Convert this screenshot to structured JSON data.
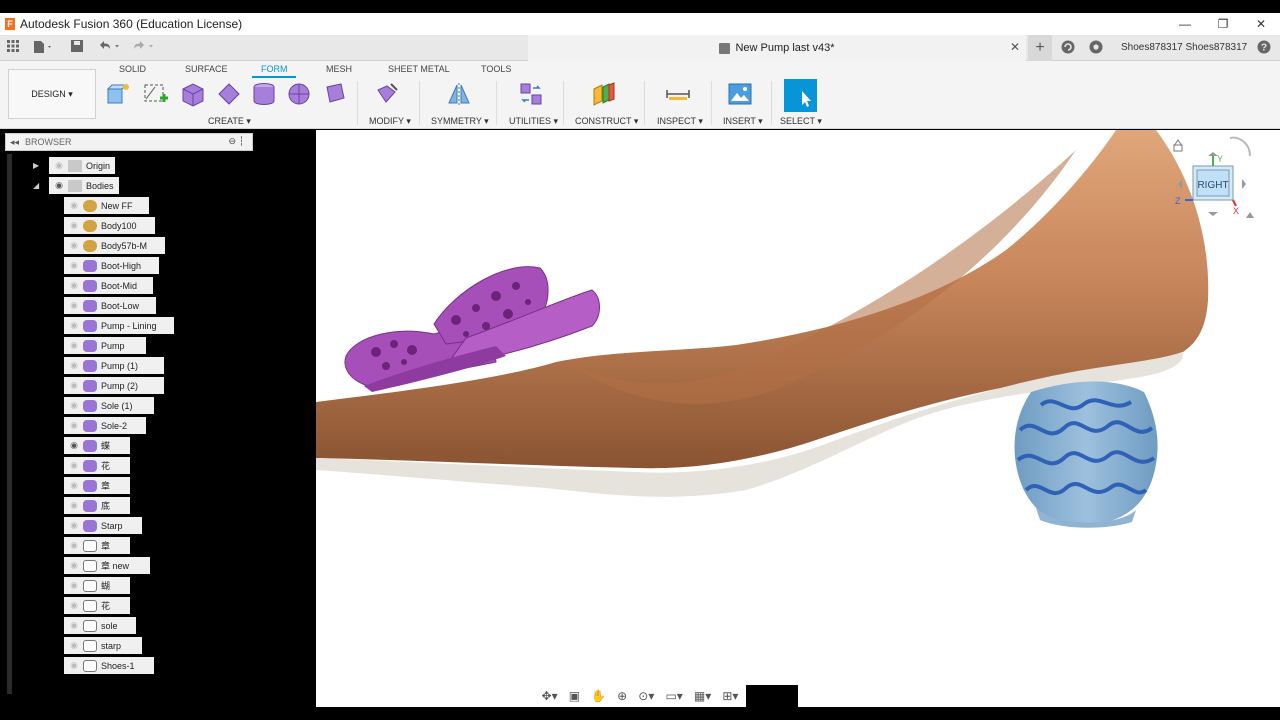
{
  "window": {
    "title": "Autodesk Fusion 360 (Education License)",
    "app_icon_letter": "F",
    "minimize": "—",
    "restore": "❐",
    "close": "✕"
  },
  "quick_access": {
    "document_title": "New Pump last v43*",
    "close_tab": "✕",
    "new_tab": "+",
    "user_name": "Shoes878317 Shoes878317"
  },
  "toolbar": {
    "workspace": "DESIGN ▾",
    "tabs": [
      "SOLID",
      "SURFACE",
      "FORM",
      "MESH",
      "SHEET METAL",
      "TOOLS"
    ],
    "active_tab": "FORM",
    "groups": [
      "CREATE ▾",
      "MODIFY ▾",
      "SYMMETRY ▾",
      "UTILITIES ▾",
      "CONSTRUCT ▾",
      "INSPECT ▾",
      "INSERT ▾",
      "SELECT ▾"
    ]
  },
  "browser": {
    "header": "BROWSER",
    "folders": [
      "Origin",
      "Bodies"
    ],
    "bodies": [
      {
        "label": "New FF",
        "type": "gold"
      },
      {
        "label": "Body100",
        "type": "gold"
      },
      {
        "label": "Body57b-M",
        "type": "gold"
      },
      {
        "label": "Boot-High",
        "type": "purple"
      },
      {
        "label": "Boot-Mid",
        "type": "purple"
      },
      {
        "label": "Boot-Low",
        "type": "purple"
      },
      {
        "label": "Pump - Lining",
        "type": "purple"
      },
      {
        "label": "Pump",
        "type": "purple"
      },
      {
        "label": "Pump  (1)",
        "type": "purple"
      },
      {
        "label": "Pump  (2)",
        "type": "purple"
      },
      {
        "label": "Sole (1)",
        "type": "purple"
      },
      {
        "label": "Sole-2",
        "type": "purple"
      },
      {
        "label": "蝶",
        "type": "purple"
      },
      {
        "label": "花",
        "type": "purple"
      },
      {
        "label": "章",
        "type": "purple"
      },
      {
        "label": "底",
        "type": "purple"
      },
      {
        "label": "Starp",
        "type": "purple"
      },
      {
        "label": "章",
        "type": "white"
      },
      {
        "label": "章 new",
        "type": "white"
      },
      {
        "label": "蝴",
        "type": "white"
      },
      {
        "label": "花",
        "type": "white"
      },
      {
        "label": "sole",
        "type": "white"
      },
      {
        "label": "starp",
        "type": "white"
      },
      {
        "label": "Shoes-1",
        "type": "white"
      }
    ]
  },
  "viewcube": {
    "face": "RIGHT",
    "axis_y": "Y",
    "axis_z": "Z",
    "axis_x": "X"
  },
  "colors": {
    "accent": "#0696d7",
    "shoe": "#c8865a",
    "bow": "#a64fb8",
    "heel": "#7aa7c9",
    "sole": "#e6e3dc"
  }
}
